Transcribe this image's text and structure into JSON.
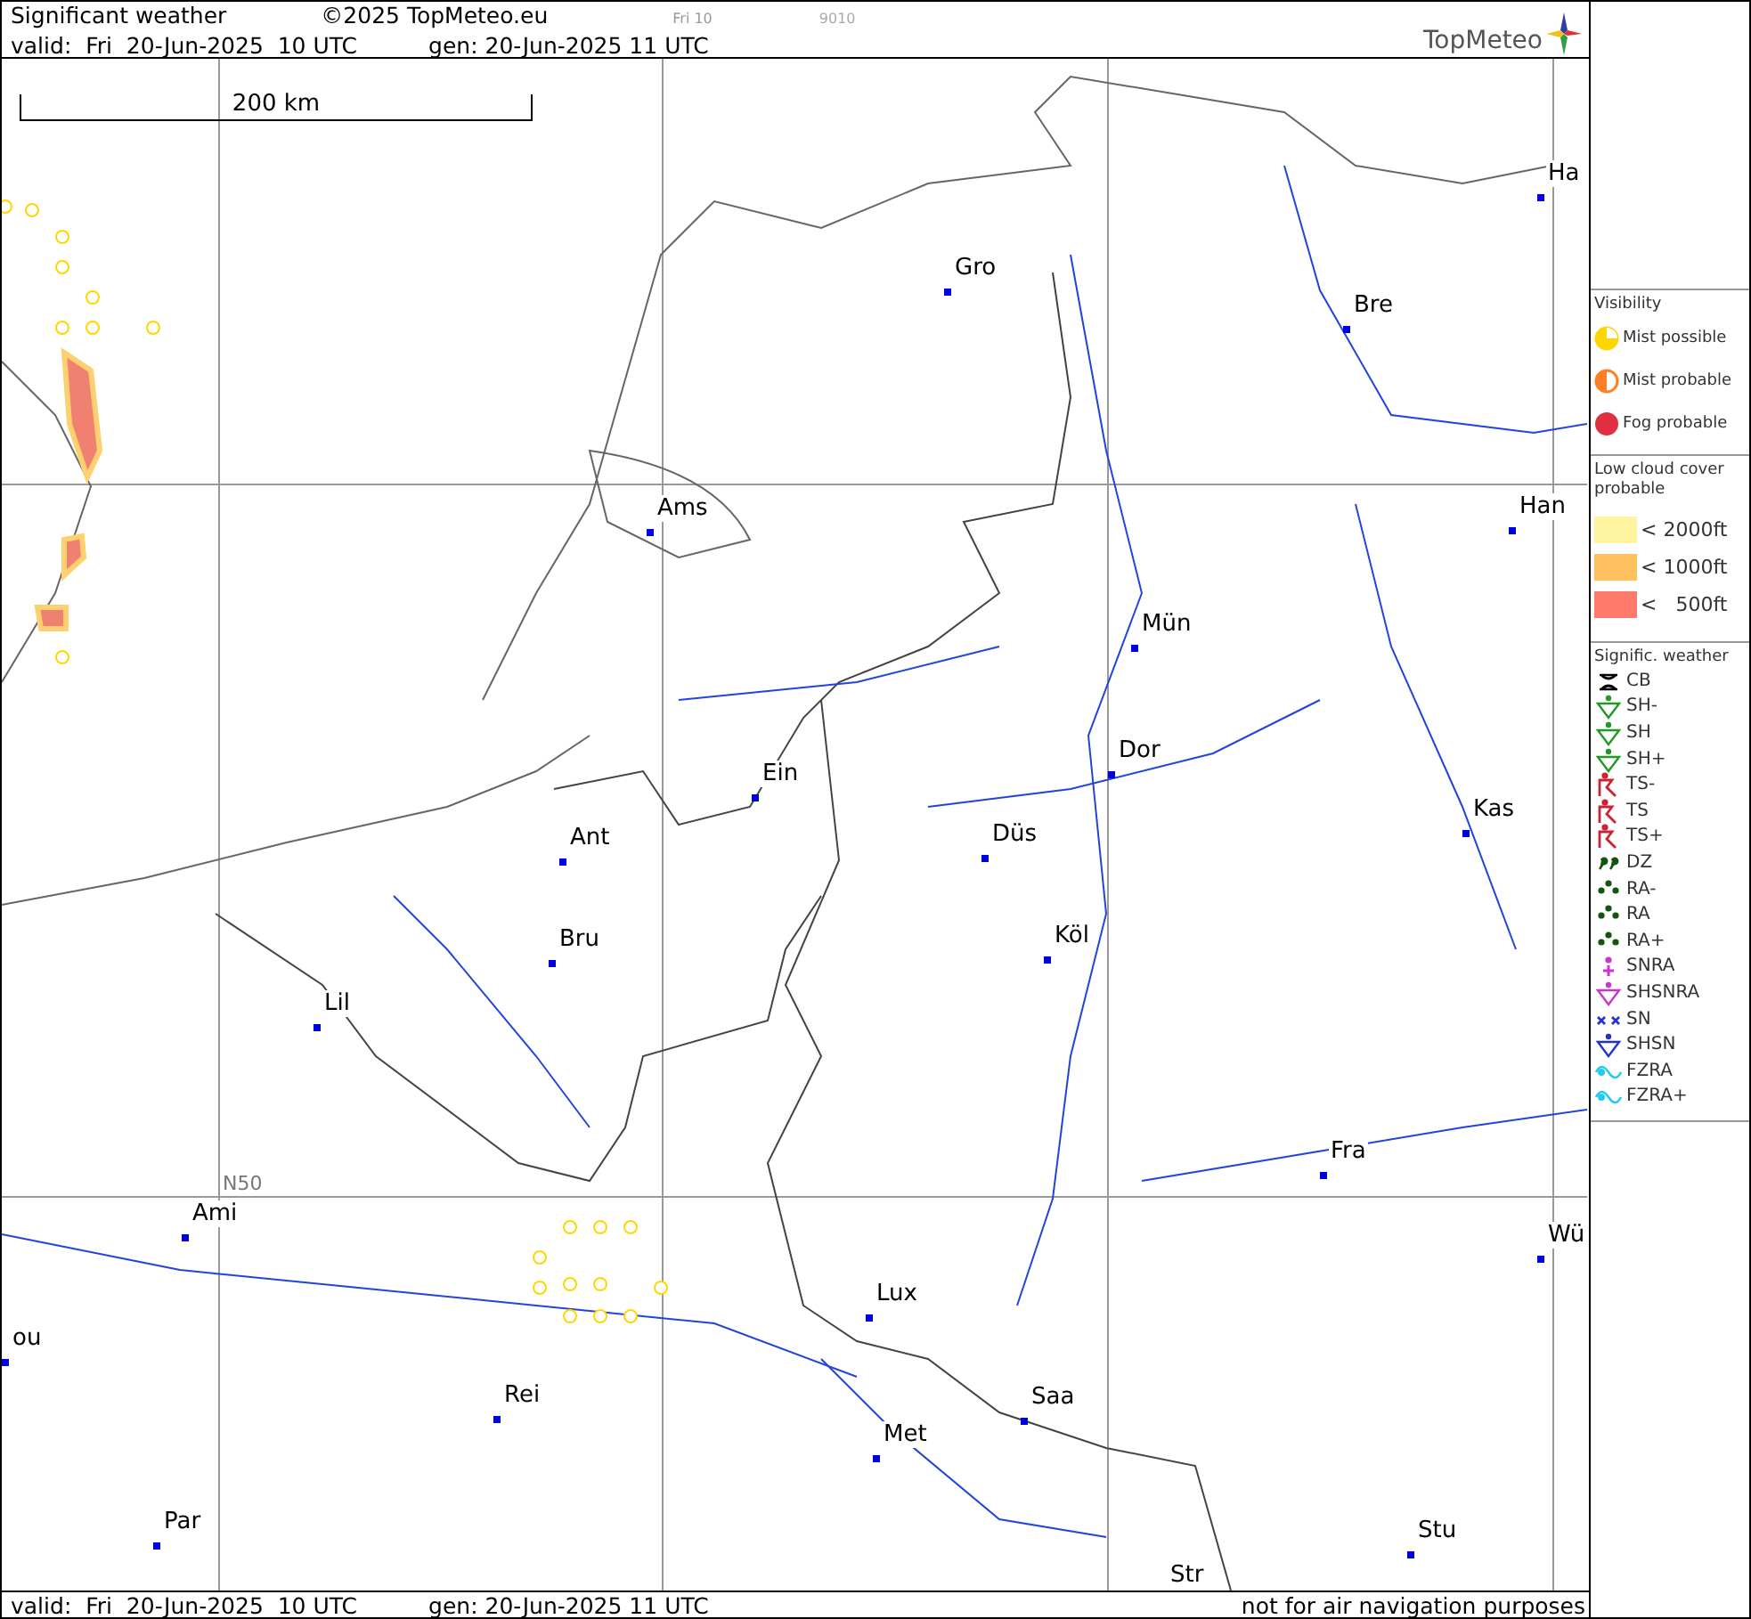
{
  "header": {
    "title": "Significant weather",
    "copyright": "©2025 TopMeteo.eu",
    "run_label": "Fri 10",
    "code": "9010",
    "valid": "valid:  Fri  20-Jun-2025  10 UTC",
    "gen": "gen: 20-Jun-2025 11 UTC",
    "logo": "TopMeteo"
  },
  "map": {
    "scale_label": "200 km",
    "grid_label": "N50",
    "cities": [
      {
        "name": "Ha"
      },
      {
        "name": "Gro"
      },
      {
        "name": "Bre"
      },
      {
        "name": "Ams"
      },
      {
        "name": "Han"
      },
      {
        "name": "Mün"
      },
      {
        "name": "Dor"
      },
      {
        "name": "Ein"
      },
      {
        "name": "Kas"
      },
      {
        "name": "Ant"
      },
      {
        "name": "Düs"
      },
      {
        "name": "Köl"
      },
      {
        "name": "Bru"
      },
      {
        "name": "Lil"
      },
      {
        "name": "Fra"
      },
      {
        "name": "Ami"
      },
      {
        "name": "Wü"
      },
      {
        "name": "Lux"
      },
      {
        "name": "Rei"
      },
      {
        "name": "Saa"
      },
      {
        "name": "Met"
      },
      {
        "name": "Par"
      },
      {
        "name": "Stu"
      },
      {
        "name": "Str"
      },
      {
        "name": "ou"
      }
    ]
  },
  "legend": {
    "visibility": {
      "title": "Visibility",
      "items": [
        {
          "kind": "half",
          "label": "Mist possible",
          "color": "#ffd700"
        },
        {
          "kind": "split",
          "label": "Mist probable",
          "color": "#ff7f27"
        },
        {
          "kind": "full",
          "label": "Fog probable",
          "color": "#e03040"
        }
      ]
    },
    "low_cloud": {
      "title": "Low cloud cover probable",
      "items": [
        {
          "label": "< 2000ft",
          "color": "#fff4a0"
        },
        {
          "label": "< 1000ft",
          "color": "#ffc060"
        },
        {
          "label": "<   500ft",
          "color": "#ff7a6a"
        }
      ]
    },
    "weather": {
      "title": "Signific. weather",
      "items": [
        {
          "kind": "cb",
          "label": "CB",
          "color": "#000000"
        },
        {
          "kind": "shower",
          "label": "SH-",
          "color": "#229922"
        },
        {
          "kind": "shower",
          "label": "SH",
          "color": "#229922"
        },
        {
          "kind": "shower",
          "label": "SH+",
          "color": "#229922"
        },
        {
          "kind": "ts",
          "label": "TS-",
          "color": "#cc2233"
        },
        {
          "kind": "ts",
          "label": "TS",
          "color": "#cc2233"
        },
        {
          "kind": "ts",
          "label": "TS+",
          "color": "#cc2233"
        },
        {
          "kind": "drizzle",
          "label": "DZ",
          "color": "#115511"
        },
        {
          "kind": "rain",
          "label": "RA-",
          "color": "#115511"
        },
        {
          "kind": "rain",
          "label": "RA",
          "color": "#115511"
        },
        {
          "kind": "rain",
          "label": "RA+",
          "color": "#115511"
        },
        {
          "kind": "snowrain",
          "label": "SNRA",
          "color": "#cc33cc"
        },
        {
          "kind": "shower",
          "label": "SHSNRA",
          "color": "#cc33cc"
        },
        {
          "kind": "snow",
          "label": "SN",
          "color": "#2233cc"
        },
        {
          "kind": "shower",
          "label": "SHSN",
          "color": "#2233cc"
        },
        {
          "kind": "freezing",
          "label": "FZRA",
          "color": "#22ccee"
        },
        {
          "kind": "freezing",
          "label": "FZRA+",
          "color": "#22ccee"
        }
      ]
    }
  },
  "footer": {
    "valid": "valid:  Fri  20-Jun-2025  10 UTC",
    "gen": "gen: 20-Jun-2025 11 UTC",
    "note": "not for air navigation purposes"
  }
}
